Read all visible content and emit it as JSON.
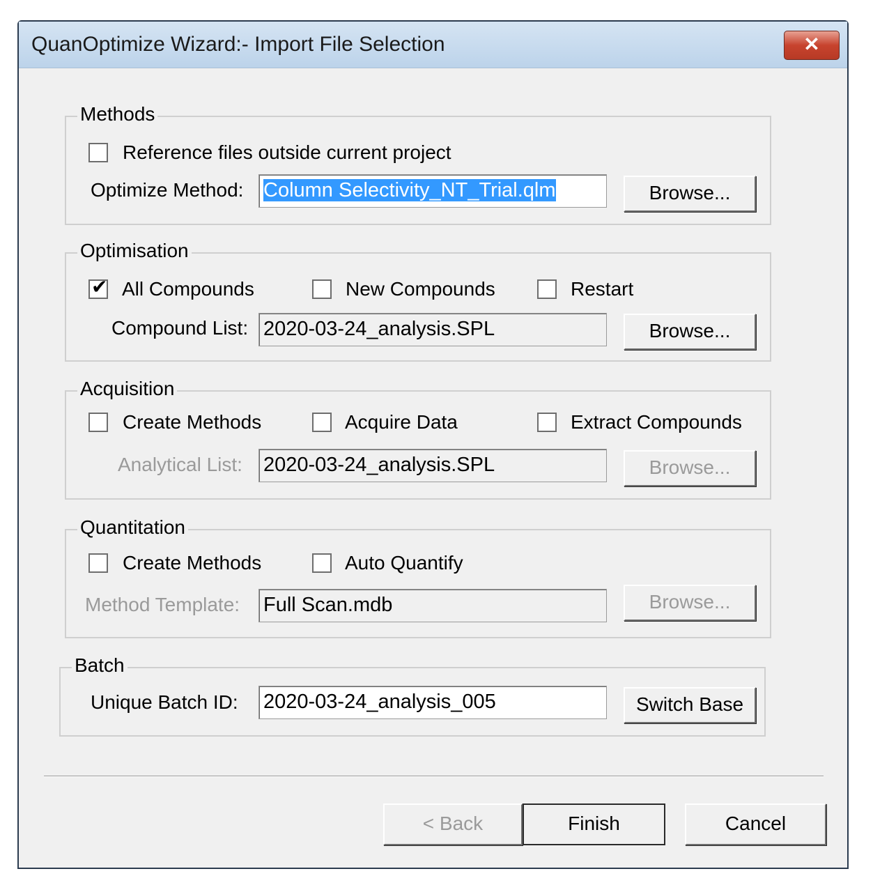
{
  "window": {
    "title": "QuanOptimize Wizard:- Import File Selection",
    "close_label": "✕"
  },
  "methods": {
    "title": "Methods",
    "ref_outside_label": "Reference files outside current project",
    "optimize_method_label": "Optimize Method:",
    "optimize_method_value": "Column Selectivity_NT_Trial.qlm",
    "browse_label": "Browse..."
  },
  "optimisation": {
    "title": "Optimisation",
    "all_compounds_label": "All Compounds",
    "all_compounds_checked": true,
    "new_compounds_label": "New Compounds",
    "restart_label": "Restart",
    "compound_list_label": "Compound List:",
    "compound_list_value": "2020-03-24_analysis.SPL",
    "browse_label": "Browse..."
  },
  "acquisition": {
    "title": "Acquisition",
    "create_methods_label": "Create Methods",
    "acquire_data_label": "Acquire Data",
    "extract_compounds_label": "Extract Compounds",
    "analytical_list_label": "Analytical List:",
    "analytical_list_value": "2020-03-24_analysis.SPL",
    "browse_label": "Browse..."
  },
  "quantitation": {
    "title": "Quantitation",
    "create_methods_label": "Create Methods",
    "auto_quantify_label": "Auto Quantify",
    "method_template_label": "Method Template:",
    "method_template_value": "Full Scan.mdb",
    "browse_label": "Browse..."
  },
  "batch": {
    "title": "Batch",
    "unique_batch_id_label": "Unique Batch ID:",
    "unique_batch_id_value": "2020-03-24_analysis_005",
    "switch_base_label": "Switch Base"
  },
  "footer": {
    "back_label": "< Back",
    "finish_label": "Finish",
    "cancel_label": "Cancel"
  }
}
